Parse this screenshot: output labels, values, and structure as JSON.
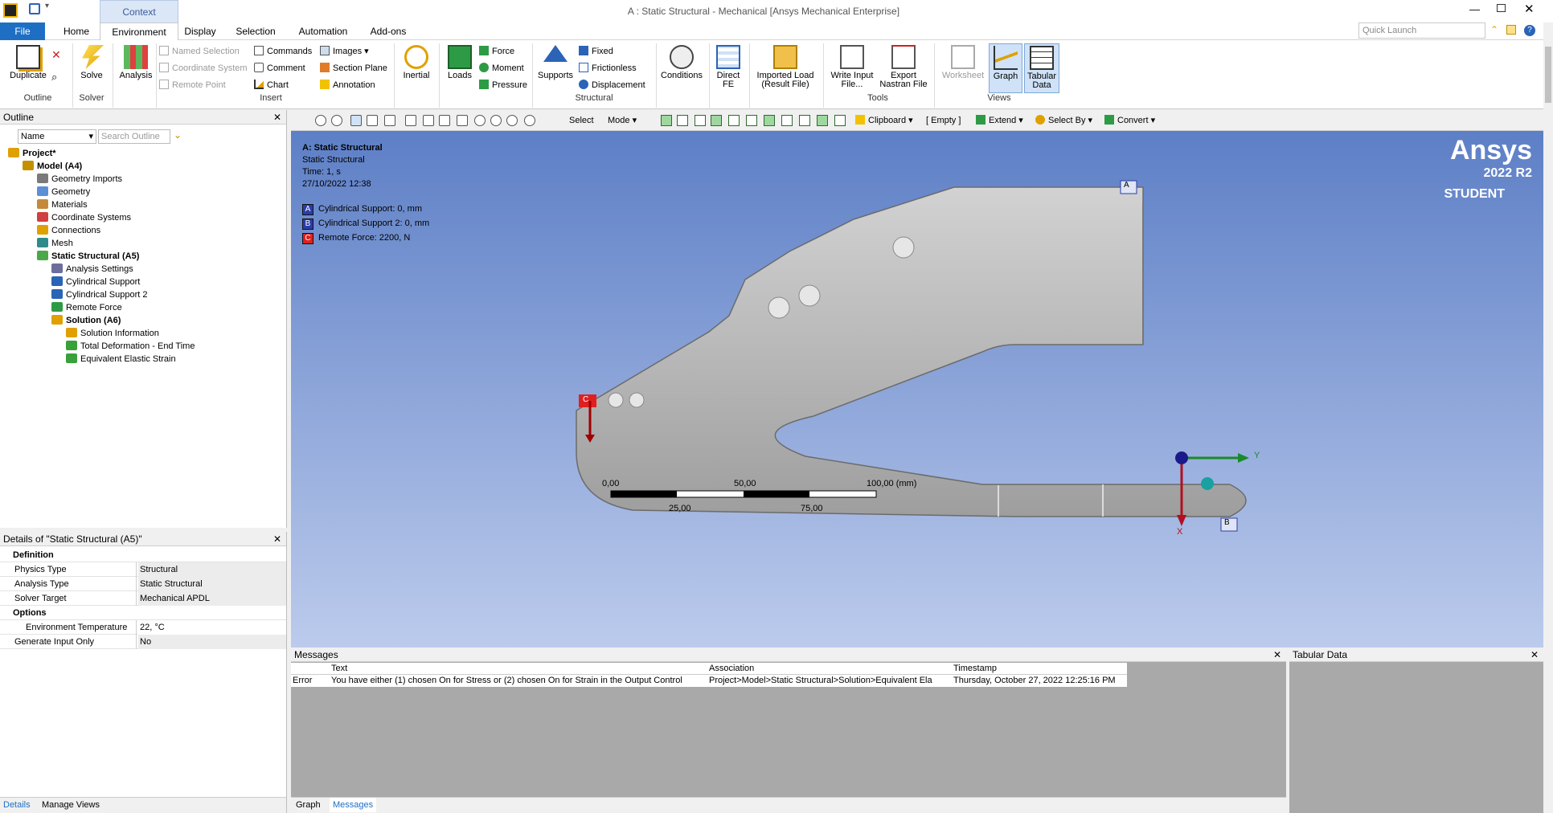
{
  "window": {
    "title": "A : Static Structural - Mechanical [Ansys Mechanical Enterprise]",
    "context_label": "Context",
    "quick_launch_placeholder": "Quick Launch"
  },
  "ribbon_tabs": [
    "File",
    "Home",
    "Environment",
    "Display",
    "Selection",
    "Automation",
    "Add-ons"
  ],
  "ribbon": {
    "outline_group": {
      "duplicate": "Duplicate",
      "label": "Outline"
    },
    "solver_group": {
      "solve": "Solve",
      "label": "Solver"
    },
    "analysis": "Analysis",
    "insert": {
      "named_selection": "Named Selection",
      "coordinate_system": "Coordinate System",
      "remote_point": "Remote Point",
      "commands": "Commands",
      "comment": "Comment",
      "chart": "Chart",
      "images": "Images",
      "section_plane": "Section Plane",
      "annotation": "Annotation",
      "label": "Insert"
    },
    "inertial": "Inertial",
    "loads": "Loads",
    "force": "Force",
    "moment": "Moment",
    "pressure": "Pressure",
    "supports": "Supports",
    "fixed": "Fixed",
    "frictionless": "Frictionless",
    "displacement": "Displacement",
    "structural_label": "Structural",
    "conditions": "Conditions",
    "direct_fe": "Direct FE",
    "imported_load": "Imported Load (Result File)",
    "write_input": "Write Input File...",
    "export_nastran": "Export Nastran File",
    "tools_label": "Tools",
    "worksheet": "Worksheet",
    "graph": "Graph",
    "tabular": "Tabular Data",
    "views_label": "Views"
  },
  "outline": {
    "title": "Outline",
    "filter_name": "Name",
    "search_placeholder": "Search Outline",
    "tree": [
      {
        "label": "Project*",
        "level": 0,
        "bold": true
      },
      {
        "label": "Model (A4)",
        "level": 1,
        "bold": true
      },
      {
        "label": "Geometry Imports",
        "level": 2
      },
      {
        "label": "Geometry",
        "level": 2
      },
      {
        "label": "Materials",
        "level": 2
      },
      {
        "label": "Coordinate Systems",
        "level": 2
      },
      {
        "label": "Connections",
        "level": 2
      },
      {
        "label": "Mesh",
        "level": 2
      },
      {
        "label": "Static Structural (A5)",
        "level": 2,
        "bold": true
      },
      {
        "label": "Analysis Settings",
        "level": 3
      },
      {
        "label": "Cylindrical Support",
        "level": 3
      },
      {
        "label": "Cylindrical Support 2",
        "level": 3
      },
      {
        "label": "Remote Force",
        "level": 3
      },
      {
        "label": "Solution (A6)",
        "level": 3,
        "bold": true
      },
      {
        "label": "Solution Information",
        "level": 4
      },
      {
        "label": "Total Deformation - End Time",
        "level": 4
      },
      {
        "label": "Equivalent Elastic Strain",
        "level": 4
      }
    ]
  },
  "details": {
    "title": "Details of \"Static Structural (A5)\"",
    "definition_label": "Definition",
    "options_label": "Options",
    "rows": [
      {
        "key": "Physics Type",
        "value": "Structural"
      },
      {
        "key": "Analysis Type",
        "value": "Static Structural"
      },
      {
        "key": "Solver Target",
        "value": "Mechanical APDL"
      },
      {
        "key": "Environment Temperature",
        "value": "22, °C"
      },
      {
        "key": "Generate Input Only",
        "value": "No"
      }
    ],
    "tabs": [
      "Details",
      "Manage Views"
    ]
  },
  "view_toolbar": {
    "select": "Select",
    "mode": "Mode",
    "clipboard": "Clipboard",
    "empty": "[ Empty ]",
    "extend": "Extend",
    "select_by": "Select By",
    "convert": "Convert"
  },
  "viewport": {
    "analysis_title": "A: Static Structural",
    "analysis_type": "Static Structural",
    "time": "Time: 1, s",
    "date": "27/10/2022 12:38",
    "legend": [
      {
        "tag": "A",
        "text": "Cylindrical Support: 0, mm",
        "color": "#2b3da8"
      },
      {
        "tag": "B",
        "text": "Cylindrical Support 2: 0, mm",
        "color": "#2b3da8"
      },
      {
        "tag": "C",
        "text": "Remote Force: 2200, N",
        "color": "#e02020"
      }
    ],
    "brand": "Ansys",
    "version": "2022 R2",
    "edition": "STUDENT",
    "scale": {
      "t0": "0,00",
      "t50": "50,00",
      "t100": "100,00 (mm)",
      "t25": "25,00",
      "t75": "75,00"
    },
    "axis_y": "Y",
    "axis_x": "X"
  },
  "messages": {
    "title": "Messages",
    "columns": [
      "Text",
      "Association",
      "Timestamp"
    ],
    "rows": [
      {
        "level": "Error",
        "text": "You have either (1) chosen On for Stress or (2) chosen On for Strain in the Output Control",
        "association": "Project>Model>Static Structural>Solution>Equivalent Ela",
        "timestamp": "Thursday, October 27, 2022 12:25:16 PM"
      }
    ],
    "tabs": [
      "Graph",
      "Messages"
    ]
  },
  "tabular_title": "Tabular Data"
}
